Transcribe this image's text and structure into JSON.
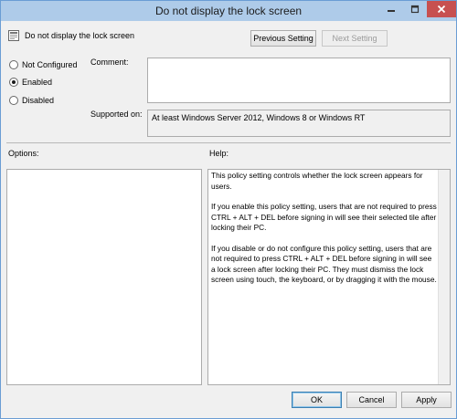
{
  "window": {
    "title": "Do not display the lock screen"
  },
  "policy": {
    "name": "Do not display the lock screen"
  },
  "nav": {
    "previous": "Previous Setting",
    "next": "Next Setting"
  },
  "state": {
    "options": [
      {
        "label": "Not Configured",
        "checked": false
      },
      {
        "label": "Enabled",
        "checked": true
      },
      {
        "label": "Disabled",
        "checked": false
      }
    ]
  },
  "comment": {
    "label": "Comment:",
    "value": ""
  },
  "supported": {
    "label": "Supported on:",
    "value": "At least Windows Server 2012, Windows 8 or Windows RT"
  },
  "options_section": {
    "label": "Options:"
  },
  "help": {
    "label": "Help:",
    "paragraphs": [
      "This policy setting controls whether the lock screen appears for users.",
      "If you enable this policy setting, users that are not required to press CTRL + ALT + DEL before signing in will see their selected tile after  locking their PC.",
      "If you disable or do not configure this policy setting, users that are not required to press CTRL + ALT + DEL before signing in will see a lock screen after locking their PC. They must dismiss the lock screen using touch, the keyboard, or by dragging it with the mouse."
    ]
  },
  "footer": {
    "ok": "OK",
    "cancel": "Cancel",
    "apply": "Apply"
  },
  "colors": {
    "titlebar": "#aecbe9",
    "close": "#c75050",
    "border": "#6a9dd4"
  }
}
